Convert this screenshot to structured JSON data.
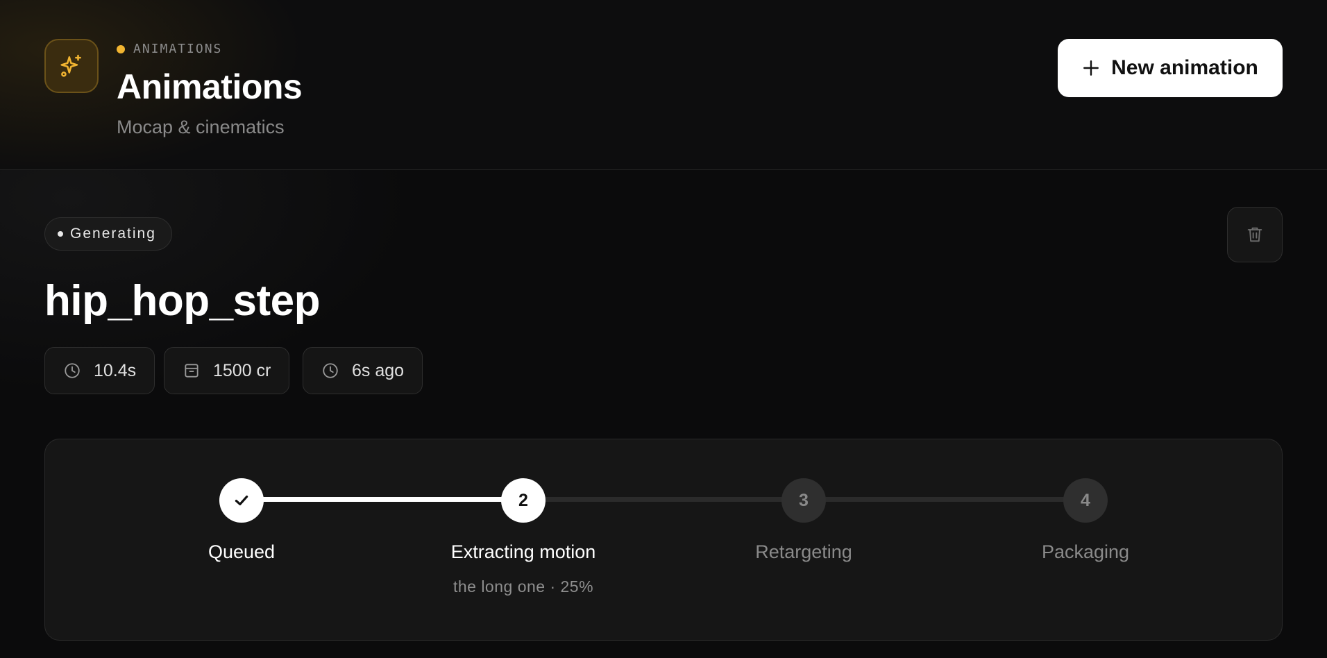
{
  "header": {
    "eyebrow": "ANIMATIONS",
    "title": "Animations",
    "subtitle": "Mocap & cinematics",
    "app_icon": "sparkles-icon",
    "new_button_label": "New animation",
    "new_button_icon": "plus-icon"
  },
  "animation": {
    "status": "Generating",
    "name": "hip_hop_step",
    "delete_icon": "trash-icon",
    "meta": [
      {
        "icon": "clock-icon",
        "value": "10.4s"
      },
      {
        "icon": "box-icon",
        "value": "1500 cr"
      },
      {
        "icon": "clock-icon",
        "value": "6s ago"
      }
    ]
  },
  "progress": {
    "current_step": 2,
    "steps": [
      {
        "number": "1",
        "label": "Queued",
        "state": "done",
        "detail": ""
      },
      {
        "number": "2",
        "label": "Extracting motion",
        "state": "active",
        "detail": "the long one · 25%"
      },
      {
        "number": "3",
        "label": "Retargeting",
        "state": "pending",
        "detail": ""
      },
      {
        "number": "4",
        "label": "Packaging",
        "state": "pending",
        "detail": ""
      }
    ]
  },
  "colors": {
    "accent": "#f2b531",
    "background": "#0b0b0c",
    "card": "#161616",
    "muted_text": "#8a8a8a"
  }
}
